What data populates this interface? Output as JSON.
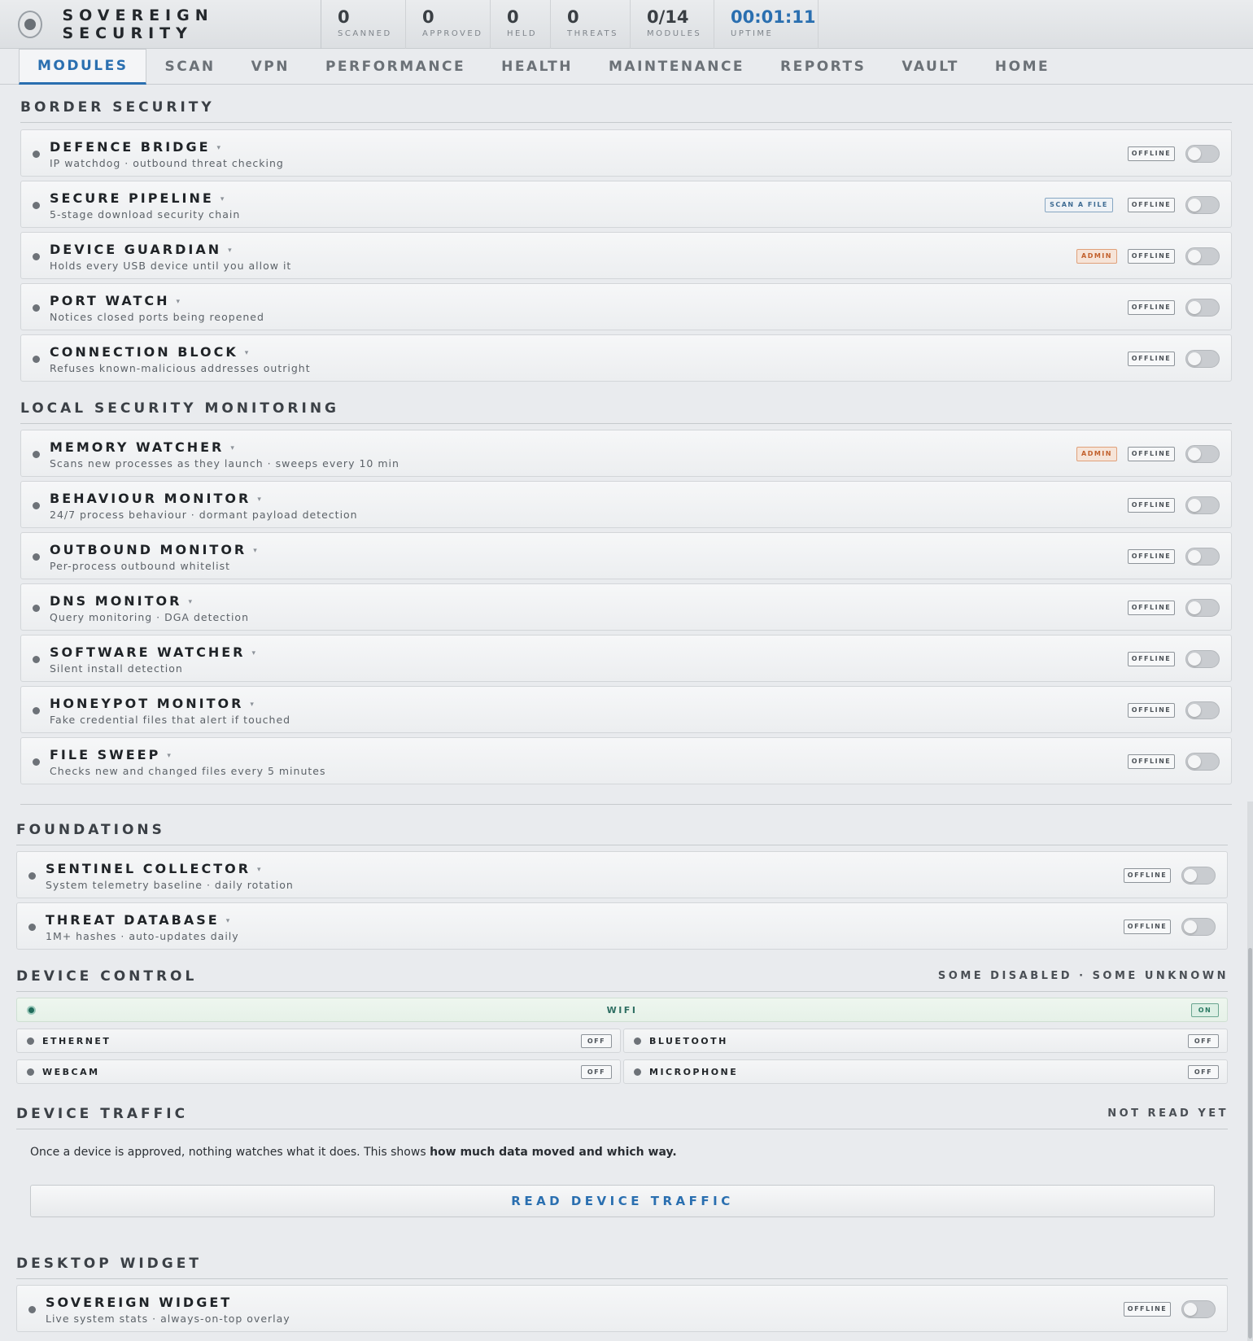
{
  "app": {
    "title": "SOVEREIGN SECURITY"
  },
  "stats": [
    {
      "value": "0",
      "label": "SCANNED"
    },
    {
      "value": "0",
      "label": "APPROVED"
    },
    {
      "value": "0",
      "label": "HELD"
    },
    {
      "value": "0",
      "label": "THREATS"
    },
    {
      "value": "0/14",
      "label": "MODULES"
    },
    {
      "value": "00:01:11",
      "label": "UPTIME"
    }
  ],
  "tabs": [
    "MODULES",
    "SCAN",
    "VPN",
    "PERFORMANCE",
    "HEALTH",
    "MAINTENANCE",
    "REPORTS",
    "VAULT",
    "HOME"
  ],
  "sections": {
    "border": {
      "title": "BORDER SECURITY",
      "items": [
        {
          "name": "DEFENCE BRIDGE",
          "desc": "IP watchdog · outbound threat checking",
          "status": "OFFLINE"
        },
        {
          "name": "SECURE PIPELINE",
          "desc": "5-stage download security chain",
          "status": "OFFLINE",
          "action": "SCAN A FILE"
        },
        {
          "name": "DEVICE GUARDIAN",
          "desc": "Holds every USB device until you allow it",
          "status": "OFFLINE",
          "tag": "ADMIN"
        },
        {
          "name": "PORT WATCH",
          "desc": "Notices closed ports being reopened",
          "status": "OFFLINE"
        },
        {
          "name": "CONNECTION BLOCK",
          "desc": "Refuses known-malicious addresses outright",
          "status": "OFFLINE"
        }
      ]
    },
    "local": {
      "title": "LOCAL SECURITY MONITORING",
      "items": [
        {
          "name": "MEMORY WATCHER",
          "desc": "Scans new processes as they launch · sweeps every 10 min",
          "status": "OFFLINE",
          "tag": "ADMIN"
        },
        {
          "name": "BEHAVIOUR MONITOR",
          "desc": "24/7 process behaviour · dormant payload detection",
          "status": "OFFLINE"
        },
        {
          "name": "OUTBOUND MONITOR",
          "desc": "Per-process outbound whitelist",
          "status": "OFFLINE"
        },
        {
          "name": "DNS MONITOR",
          "desc": "Query monitoring · DGA detection",
          "status": "OFFLINE"
        },
        {
          "name": "SOFTWARE WATCHER",
          "desc": "Silent install detection",
          "status": "OFFLINE"
        },
        {
          "name": "HONEYPOT MONITOR",
          "desc": "Fake credential files that alert if touched",
          "status": "OFFLINE"
        },
        {
          "name": "FILE SWEEP",
          "desc": "Checks new and changed files every 5 minutes",
          "status": "OFFLINE"
        }
      ]
    },
    "foundations": {
      "title": "FOUNDATIONS",
      "items": [
        {
          "name": "SENTINEL COLLECTOR",
          "desc": "System telemetry baseline · daily rotation",
          "status": "OFFLINE"
        },
        {
          "name": "THREAT DATABASE",
          "desc": "1M+ hashes · auto-updates daily",
          "status": "OFFLINE"
        }
      ]
    },
    "device_control": {
      "title": "DEVICE CONTROL",
      "summary": "SOME DISABLED · SOME UNKNOWN",
      "devices": [
        {
          "name": "WIFI",
          "state": "ON"
        },
        {
          "name": "ETHERNET",
          "state": "OFF"
        },
        {
          "name": "BLUETOOTH",
          "state": "OFF"
        },
        {
          "name": "WEBCAM",
          "state": "OFF"
        },
        {
          "name": "MICROPHONE",
          "state": "OFF"
        }
      ]
    },
    "traffic": {
      "title": "DEVICE TRAFFIC",
      "status": "NOT READ YET",
      "text": "Once a device is approved, nothing watches what it does. This shows ",
      "text_bold": "how much data moved and which way",
      "text_end": ".",
      "button": "READ DEVICE TRAFFIC"
    },
    "widget": {
      "title": "DESKTOP WIDGET",
      "items": [
        {
          "name": "SOVEREIGN WIDGET",
          "desc": "Live system stats · always-on-top overlay",
          "status": "OFFLINE"
        }
      ]
    }
  },
  "colors": {
    "accent": "#2a6fb0",
    "admin": "#c2602c",
    "on": "#2a7a63"
  }
}
